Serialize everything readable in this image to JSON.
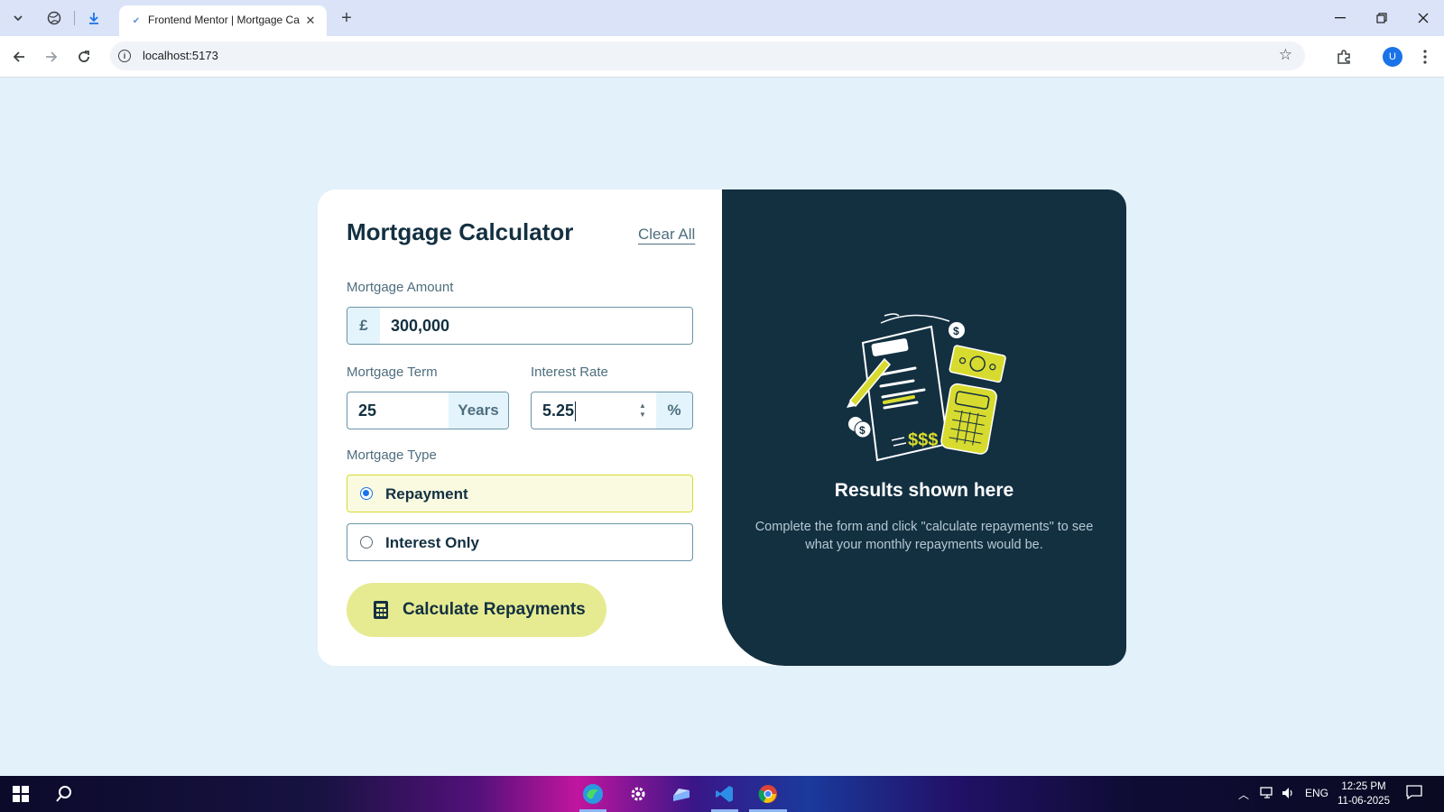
{
  "browser": {
    "tab_title": "Frontend Mentor | Mortgage Calculator",
    "url": "localhost:5173",
    "profile_initial": "U"
  },
  "calculator": {
    "title": "Mortgage Calculator",
    "clear_all": "Clear All",
    "amount": {
      "label": "Mortgage Amount",
      "prefix": "£",
      "value": "300,000"
    },
    "term": {
      "label": "Mortgage Term",
      "value": "25",
      "suffix": "Years"
    },
    "rate": {
      "label": "Interest Rate",
      "value": "5.25",
      "suffix": "%"
    },
    "type": {
      "label": "Mortgage Type",
      "options": [
        {
          "label": "Repayment",
          "selected": true
        },
        {
          "label": "Interest Only",
          "selected": false
        }
      ]
    },
    "submit_label": "Calculate Repayments"
  },
  "results": {
    "title": "Results shown here",
    "description": "Complete the form and click \"calculate repayments\" to see what your monthly repayments would be."
  },
  "taskbar": {
    "language": "ENG",
    "time": "12:25 PM",
    "date": "11-06-2025"
  },
  "colors": {
    "page_bg": "#e3f1fb",
    "dark_slate": "#133041",
    "lime": "#d8db2f",
    "lime_button": "#e6eb91",
    "label_slate": "#4e6e7e"
  }
}
